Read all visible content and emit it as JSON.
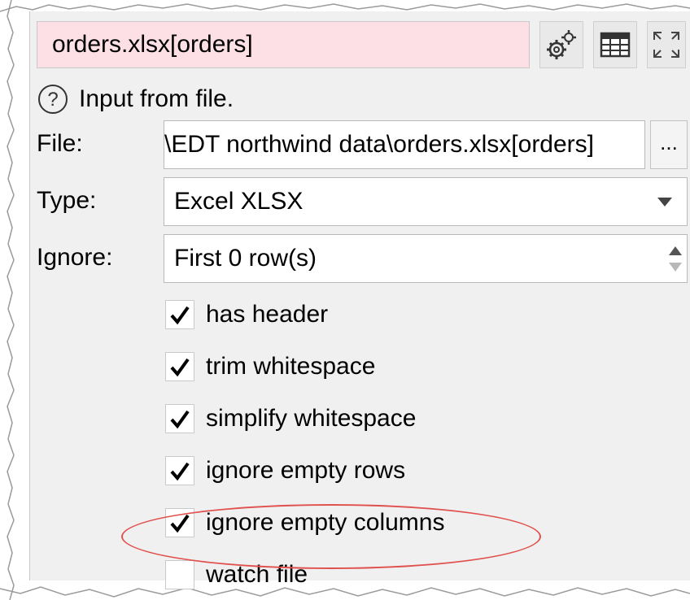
{
  "panel": {
    "title": "orders.xlsx[orders]",
    "help_text": "Input from file.",
    "toolbar": {
      "options_icon": "gears-icon",
      "table_icon": "table-icon",
      "expand_icon": "expand-icon"
    }
  },
  "form": {
    "file": {
      "label": "File:",
      "value": "\\EDT northwind data\\orders.xlsx[orders]",
      "browse_label": "..."
    },
    "type": {
      "label": "Type:",
      "value": "Excel XLSX"
    },
    "ignore": {
      "label": "Ignore:",
      "value": "First 0 row(s)"
    }
  },
  "options": [
    {
      "label": "has header",
      "checked": true
    },
    {
      "label": "trim whitespace",
      "checked": true
    },
    {
      "label": "simplify whitespace",
      "checked": true
    },
    {
      "label": "ignore empty rows",
      "checked": true
    },
    {
      "label": "ignore empty columns",
      "checked": true
    },
    {
      "label": "watch file",
      "checked": false
    }
  ],
  "colors": {
    "title_background": "#fde0e6",
    "highlight": "#e0504d"
  }
}
